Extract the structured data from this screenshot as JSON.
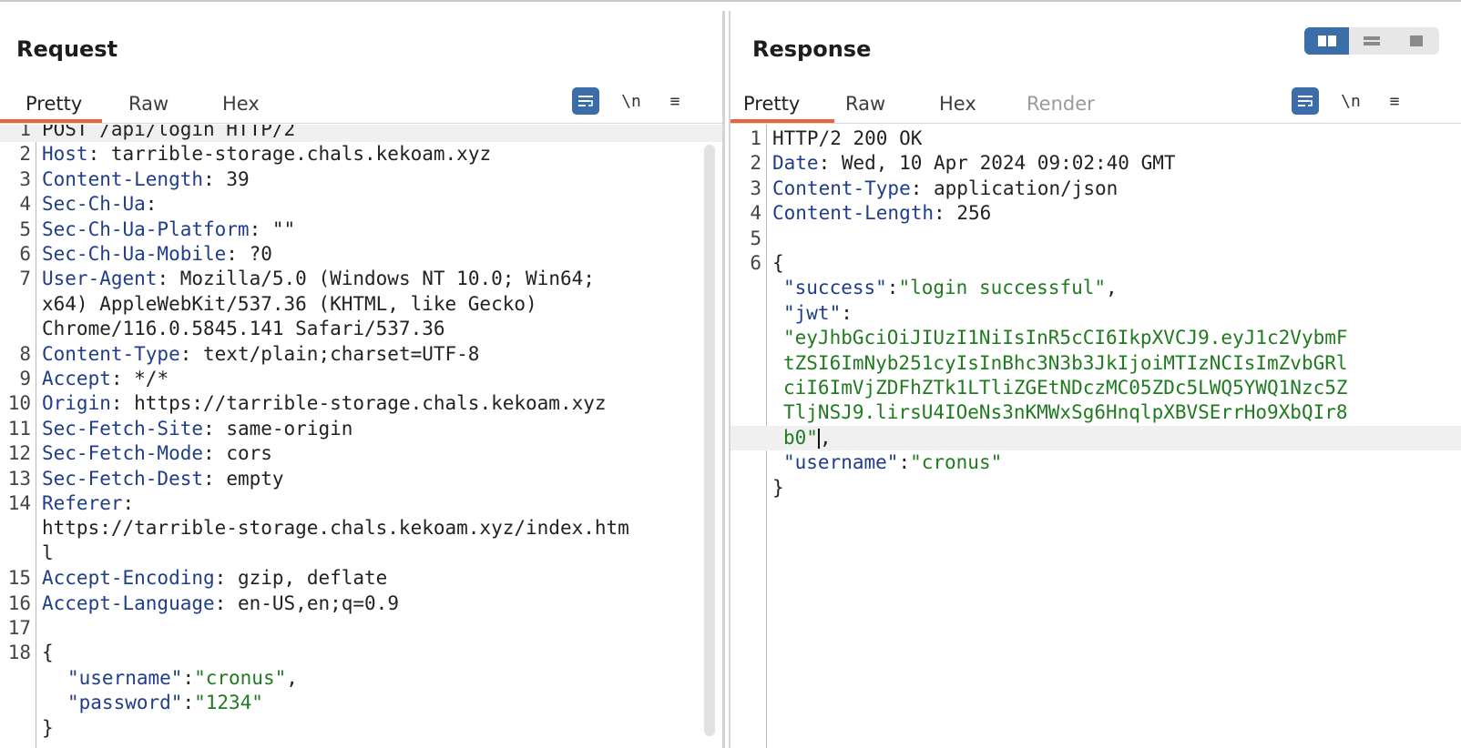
{
  "request": {
    "title": "Request",
    "tabs": [
      {
        "label": "Pretty",
        "active": true
      },
      {
        "label": "Raw",
        "active": false
      },
      {
        "label": "Hex",
        "active": false
      }
    ],
    "tools": {
      "wrap_icon": "wrap-lines-icon",
      "newline_label": "\\n",
      "menu_label": "≡"
    },
    "lines": [
      {
        "n": "1",
        "text": "POST /api/login HTTP/2"
      },
      {
        "n": "2",
        "key": "Host",
        "val": " tarrible-storage.chals.kekoam.xyz"
      },
      {
        "n": "3",
        "key": "Content-Length",
        "val": " 39"
      },
      {
        "n": "4",
        "key": "Sec-Ch-Ua",
        "val": ""
      },
      {
        "n": "5",
        "key": "Sec-Ch-Ua-Platform",
        "val": " \"\""
      },
      {
        "n": "6",
        "key": "Sec-Ch-Ua-Mobile",
        "val": " ?0"
      },
      {
        "n": "7",
        "key": "User-Agent",
        "val": " Mozilla/5.0 (Windows NT 10.0; Win64;"
      },
      {
        "n": "",
        "text": "x64) AppleWebKit/537.36 (KHTML, like Gecko)"
      },
      {
        "n": "",
        "text": "Chrome/116.0.5845.141 Safari/537.36"
      },
      {
        "n": "8",
        "key": "Content-Type",
        "val": " text/plain;charset=UTF-8"
      },
      {
        "n": "9",
        "key": "Accept",
        "val": " */*"
      },
      {
        "n": "10",
        "key": "Origin",
        "val": " https://tarrible-storage.chals.kekoam.xyz"
      },
      {
        "n": "11",
        "key": "Sec-Fetch-Site",
        "val": " same-origin"
      },
      {
        "n": "12",
        "key": "Sec-Fetch-Mode",
        "val": " cors"
      },
      {
        "n": "13",
        "key": "Sec-Fetch-Dest",
        "val": " empty"
      },
      {
        "n": "14",
        "key": "Referer",
        "val": ""
      },
      {
        "n": "",
        "text": "https://tarrible-storage.chals.kekoam.xyz/index.htm"
      },
      {
        "n": "",
        "text": "l"
      },
      {
        "n": "15",
        "key": "Accept-Encoding",
        "val": " gzip, deflate"
      },
      {
        "n": "16",
        "key": "Accept-Language",
        "val": " en-US,en;q=0.9"
      },
      {
        "n": "17",
        "text": ""
      },
      {
        "n": "18",
        "text": "{"
      },
      {
        "n": "",
        "jkey": "\"username\"",
        "jval": "\"cronus\"",
        "trail": ","
      },
      {
        "n": "",
        "jkey": "\"password\"",
        "jval": "\"1234\"",
        "trail": ""
      },
      {
        "n": "",
        "text": "}"
      }
    ]
  },
  "response": {
    "title": "Response",
    "tabs": [
      {
        "label": "Pretty",
        "active": true
      },
      {
        "label": "Raw",
        "active": false
      },
      {
        "label": "Hex",
        "active": false
      },
      {
        "label": "Render",
        "active": false,
        "disabled": true
      }
    ],
    "tools": {
      "wrap_icon": "wrap-lines-icon",
      "newline_label": "\\n",
      "menu_label": "≡"
    },
    "lines": [
      {
        "n": "1",
        "text": "HTTP/2 200 OK"
      },
      {
        "n": "2",
        "key": "Date",
        "val": " Wed, 10 Apr 2024 09:02:40 GMT"
      },
      {
        "n": "3",
        "key": "Content-Type",
        "val": " application/json"
      },
      {
        "n": "4",
        "key": "Content-Length",
        "val": " 256"
      },
      {
        "n": "5",
        "text": ""
      },
      {
        "n": "6",
        "text": "{"
      },
      {
        "n": "",
        "jkey": "\"success\"",
        "jval": "\"login successful\"",
        "trail": ","
      },
      {
        "n": "",
        "jkey": "\"jwt\"",
        "jval": "",
        "trail": ""
      },
      {
        "n": "",
        "jstr": "\"eyJhbGciOiJIUzI1NiIsInR5cCI6IkpXVCJ9.eyJ1c2VybmF"
      },
      {
        "n": "",
        "jstr": "tZSI6ImNyb251cyIsInBhc3N3b3JkIjoiMTIzNCIsImZvbGRl"
      },
      {
        "n": "",
        "jstr": "ciI6ImVjZDFhZTk1LTliZGEtNDczMC05ZDc5LWQ5YWQ1Nzc5Z"
      },
      {
        "n": "",
        "jstr": "TljNSJ9.lirsU4IOeNs3nKMWxSg6HnqlpXBVSErrHo9XbQIr8"
      },
      {
        "n": "",
        "jstr": "b0\"",
        "trail": ",",
        "cursor": true,
        "highlight": true
      },
      {
        "n": "",
        "jkey": "\"username\"",
        "jval": "\"cronus\"",
        "trail": ""
      },
      {
        "n": "",
        "text": "}"
      }
    ]
  }
}
